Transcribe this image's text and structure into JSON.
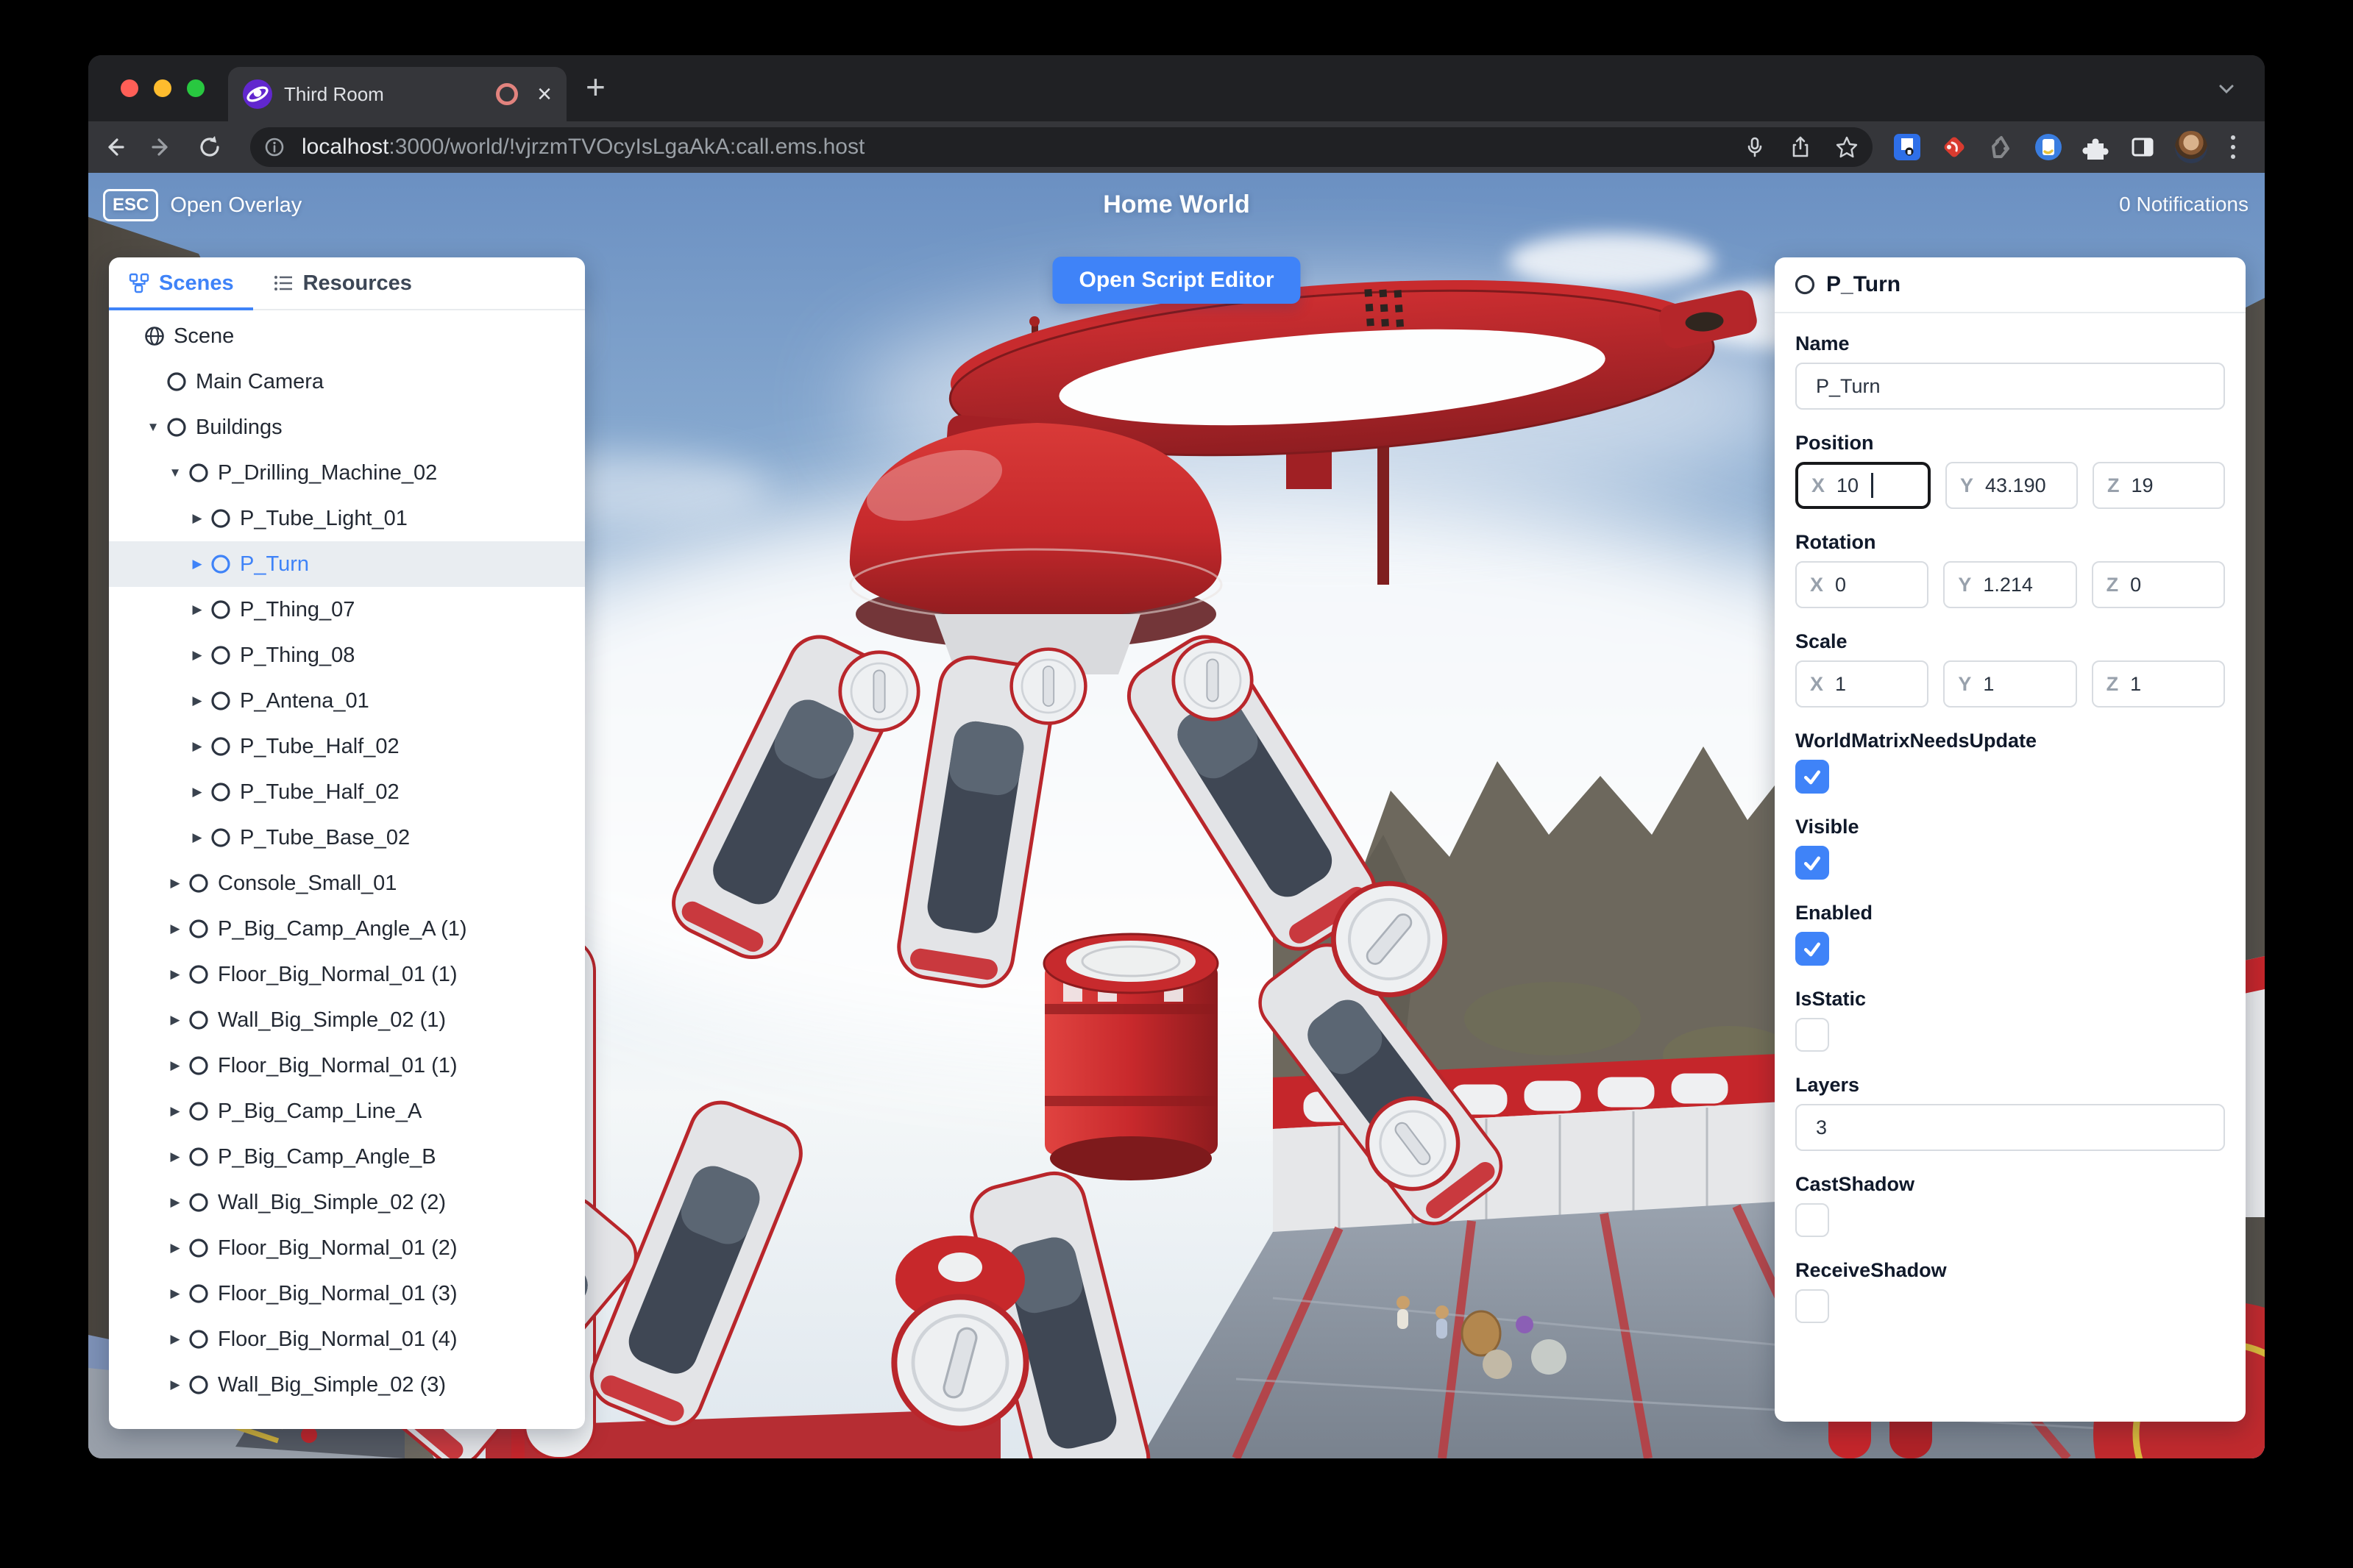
{
  "browser": {
    "tab_title": "Third Room",
    "url": "localhost:3000/world/!vjrzmTVOcyIsLgaAkA:call.ems.host",
    "url_host": "localhost",
    "url_rest": ":3000/world/!vjrzmTVOcyIsLgaAkA:call.ems.host"
  },
  "icons": {
    "close": "×",
    "new_tab": "+",
    "expander_expanded": "▼",
    "expander_collapsed": "▶"
  },
  "hud": {
    "esc_key": "ESC",
    "open_overlay": "Open Overlay",
    "world_title": "Home World",
    "notifications": "0 Notifications",
    "open_script_editor": "Open Script Editor"
  },
  "left_panel": {
    "tabs": [
      {
        "label": "Scenes",
        "active": true
      },
      {
        "label": "Resources",
        "active": false
      }
    ],
    "tree": [
      {
        "label": "Scene",
        "depth": 0,
        "icon": "globe",
        "expander": "none",
        "selected": false
      },
      {
        "label": "Main Camera",
        "depth": 1,
        "icon": "node",
        "expander": "none",
        "selected": false
      },
      {
        "label": "Buildings",
        "depth": 1,
        "icon": "node",
        "expander": "down",
        "selected": false
      },
      {
        "label": "P_Drilling_Machine_02",
        "depth": 2,
        "icon": "node",
        "expander": "down",
        "selected": false
      },
      {
        "label": "P_Tube_Light_01",
        "depth": 3,
        "icon": "node",
        "expander": "right",
        "selected": false
      },
      {
        "label": "P_Turn",
        "depth": 3,
        "icon": "node",
        "expander": "right",
        "selected": true
      },
      {
        "label": "P_Thing_07",
        "depth": 3,
        "icon": "node",
        "expander": "right",
        "selected": false
      },
      {
        "label": "P_Thing_08",
        "depth": 3,
        "icon": "node",
        "expander": "right",
        "selected": false
      },
      {
        "label": "P_Antena_01",
        "depth": 3,
        "icon": "node",
        "expander": "right",
        "selected": false
      },
      {
        "label": "P_Tube_Half_02",
        "depth": 3,
        "icon": "node",
        "expander": "right",
        "selected": false
      },
      {
        "label": "P_Tube_Half_02",
        "depth": 3,
        "icon": "node",
        "expander": "right",
        "selected": false
      },
      {
        "label": "P_Tube_Base_02",
        "depth": 3,
        "icon": "node",
        "expander": "right",
        "selected": false
      },
      {
        "label": "Console_Small_01",
        "depth": 2,
        "icon": "node",
        "expander": "right",
        "selected": false
      },
      {
        "label": "P_Big_Camp_Angle_A (1)",
        "depth": 2,
        "icon": "node",
        "expander": "right",
        "selected": false
      },
      {
        "label": "Floor_Big_Normal_01 (1)",
        "depth": 2,
        "icon": "node",
        "expander": "right",
        "selected": false
      },
      {
        "label": "Wall_Big_Simple_02 (1)",
        "depth": 2,
        "icon": "node",
        "expander": "right",
        "selected": false
      },
      {
        "label": "Floor_Big_Normal_01 (1)",
        "depth": 2,
        "icon": "node",
        "expander": "right",
        "selected": false
      },
      {
        "label": "P_Big_Camp_Line_A",
        "depth": 2,
        "icon": "node",
        "expander": "right",
        "selected": false
      },
      {
        "label": "P_Big_Camp_Angle_B",
        "depth": 2,
        "icon": "node",
        "expander": "right",
        "selected": false
      },
      {
        "label": "Wall_Big_Simple_02 (2)",
        "depth": 2,
        "icon": "node",
        "expander": "right",
        "selected": false
      },
      {
        "label": "Floor_Big_Normal_01 (2)",
        "depth": 2,
        "icon": "node",
        "expander": "right",
        "selected": false
      },
      {
        "label": "Floor_Big_Normal_01 (3)",
        "depth": 2,
        "icon": "node",
        "expander": "right",
        "selected": false
      },
      {
        "label": "Floor_Big_Normal_01 (4)",
        "depth": 2,
        "icon": "node",
        "expander": "right",
        "selected": false
      },
      {
        "label": "Wall_Big_Simple_02 (3)",
        "depth": 2,
        "icon": "node",
        "expander": "right",
        "selected": false
      }
    ]
  },
  "properties": {
    "header": "P_Turn",
    "axis": {
      "x": "X",
      "y": "Y",
      "z": "Z"
    },
    "fields": {
      "name": {
        "label": "Name",
        "value": "P_Turn"
      },
      "position": {
        "label": "Position",
        "x": "10",
        "y": "43.190",
        "z": "19"
      },
      "rotation": {
        "label": "Rotation",
        "x": "0",
        "y": "1.214",
        "z": "0"
      },
      "scale": {
        "label": "Scale",
        "x": "1",
        "y": "1",
        "z": "1"
      },
      "world_matrix": {
        "label": "WorldMatrixNeedsUpdate",
        "checked": true
      },
      "visible": {
        "label": "Visible",
        "checked": true
      },
      "enabled": {
        "label": "Enabled",
        "checked": true
      },
      "is_static": {
        "label": "IsStatic",
        "checked": false
      },
      "layers": {
        "label": "Layers",
        "value": "3"
      },
      "cast_shadow": {
        "label": "CastShadow",
        "checked": false
      },
      "receive_shadow": {
        "label": "ReceiveShadow",
        "checked": false
      }
    }
  },
  "colors": {
    "accent-blue": "#3f83f8",
    "machine-red": "#c5262b",
    "selected-row": "#e9edf1",
    "traffic-red": "#ff5f57",
    "traffic-yellow": "#febc2e",
    "traffic-green": "#28c840"
  }
}
